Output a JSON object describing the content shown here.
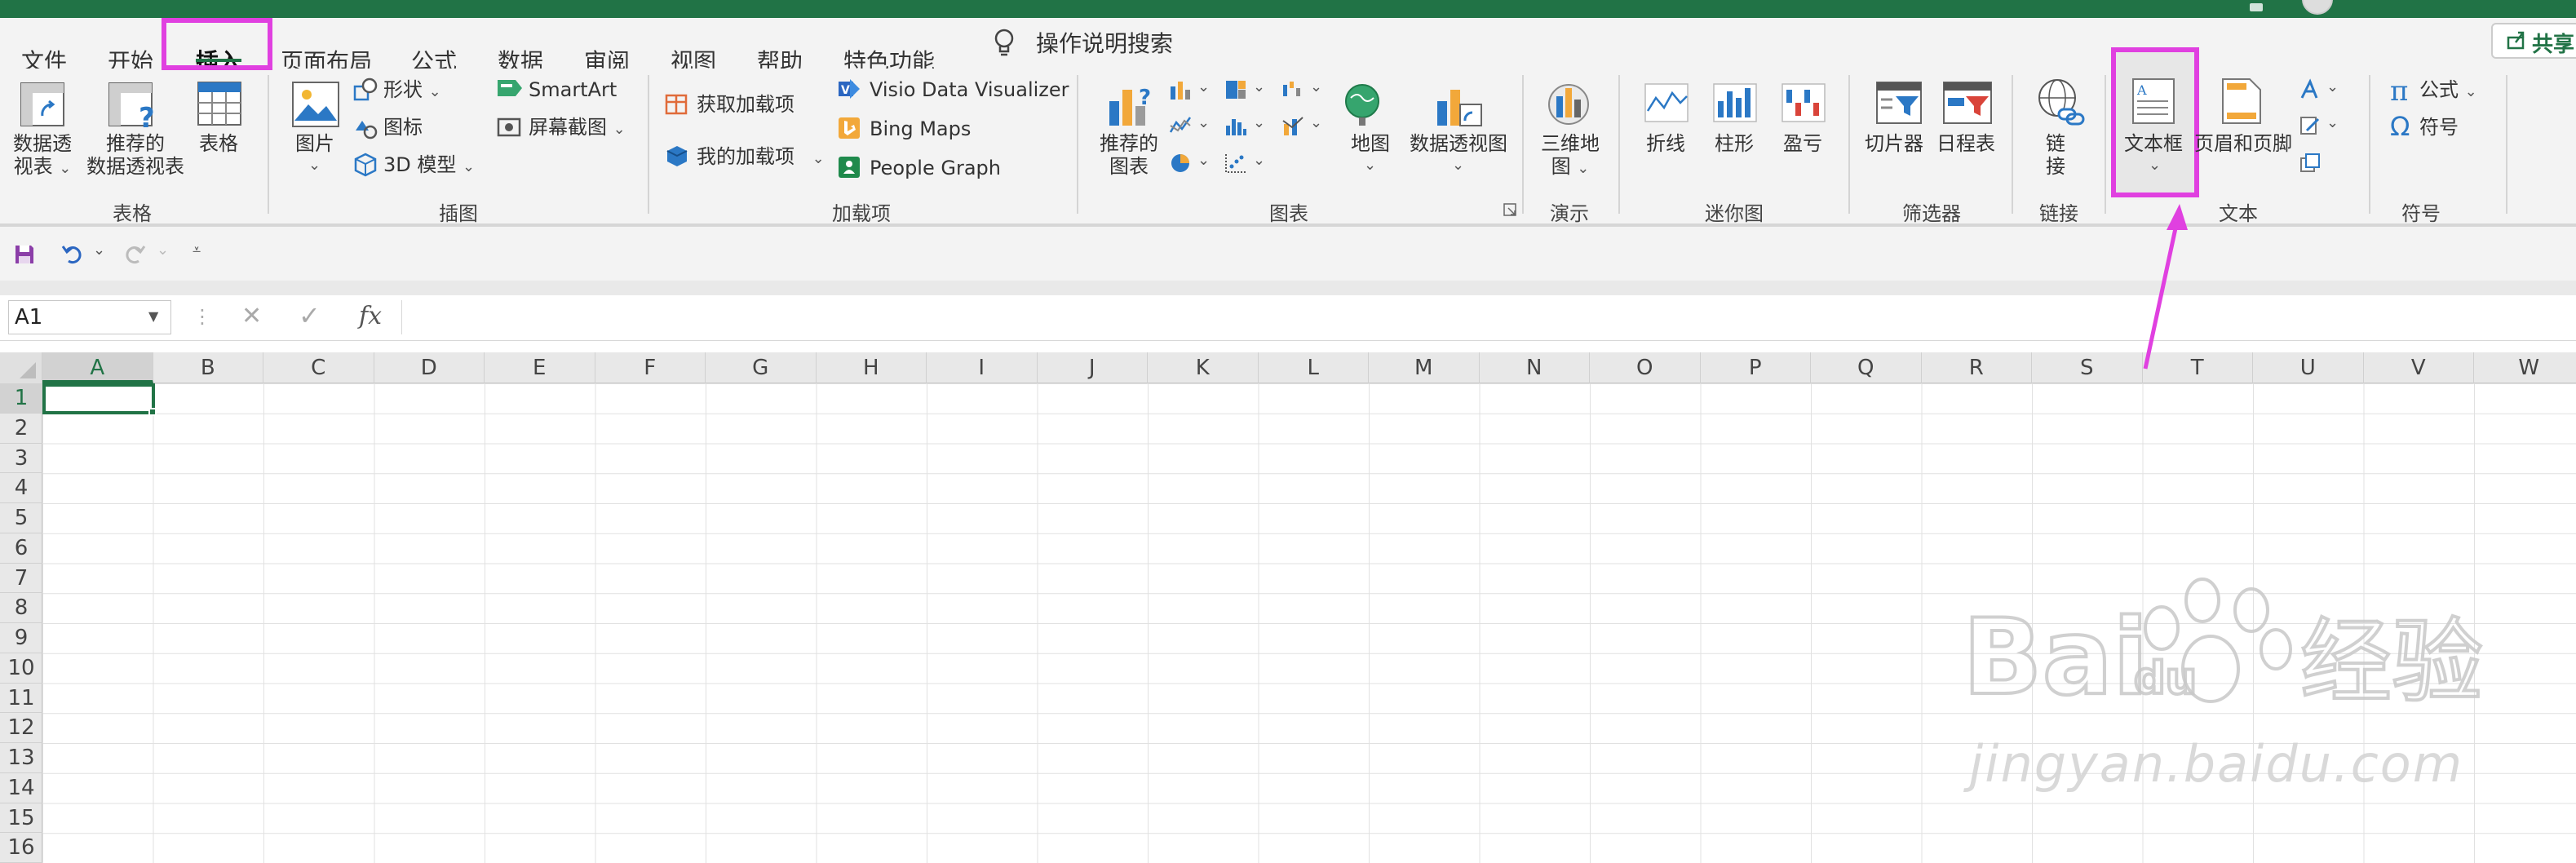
{
  "colors": {
    "brand": "#217346",
    "highlight": "#e040e0",
    "ribbon_bg": "#f3f3f3"
  },
  "tabs": [
    {
      "label": "文件"
    },
    {
      "label": "开始"
    },
    {
      "label": "插入",
      "active": true
    },
    {
      "label": "页面布局"
    },
    {
      "label": "公式"
    },
    {
      "label": "数据"
    },
    {
      "label": "审阅"
    },
    {
      "label": "视图"
    },
    {
      "label": "帮助"
    },
    {
      "label": "特色功能"
    }
  ],
  "tell_me": "操作说明搜索",
  "share_label": "共享",
  "ribbon": {
    "tables": {
      "group_label": "表格",
      "pivot_table": [
        "数据透",
        "视表"
      ],
      "recommended_pivot": [
        "推荐的",
        "数据透视表"
      ],
      "table": "表格"
    },
    "illustrations": {
      "group_label": "插图",
      "pictures": "图片",
      "shapes": "形状",
      "icons": "图标",
      "models_3d": "3D 模型",
      "smartart": "SmartArt",
      "screenshot": "屏幕截图"
    },
    "addins": {
      "group_label": "加载项",
      "get_addins": "获取加载项",
      "my_addins": "我的加载项",
      "visio": "Visio Data Visualizer",
      "bing_maps": "Bing Maps",
      "people_graph": "People Graph"
    },
    "charts": {
      "group_label": "图表",
      "recommended_charts": [
        "推荐的",
        "图表"
      ],
      "maps": "地图",
      "pivot_chart": "数据透视图"
    },
    "tours": {
      "group_label": "演示",
      "map_3d": [
        "三维地",
        "图"
      ]
    },
    "sparklines": {
      "group_label": "迷你图",
      "line": "折线",
      "column": "柱形",
      "win_loss": "盈亏"
    },
    "filters": {
      "group_label": "筛选器",
      "slicer": "切片器",
      "timeline": "日程表"
    },
    "links": {
      "group_label": "链接",
      "link": [
        "链",
        "接"
      ]
    },
    "text": {
      "group_label": "文本",
      "textbox": "文本框",
      "header_footer": "页眉和页脚"
    },
    "symbols": {
      "group_label": "符号",
      "equation": "公式",
      "symbol": "符号"
    }
  },
  "name_box": "A1",
  "fx_label": "fx",
  "columns": [
    "A",
    "B",
    "C",
    "D",
    "E",
    "F",
    "G",
    "H",
    "I",
    "J",
    "K",
    "L",
    "M",
    "N",
    "O",
    "P",
    "Q",
    "R",
    "S",
    "T",
    "U",
    "V",
    "W"
  ],
  "rows": [
    "1",
    "2",
    "3",
    "4",
    "5",
    "6",
    "7",
    "8",
    "9",
    "10",
    "11",
    "12",
    "13",
    "14",
    "15",
    "16"
  ],
  "watermark": {
    "logo": "Bai du 经验",
    "url": "jingyan.baidu.com"
  }
}
